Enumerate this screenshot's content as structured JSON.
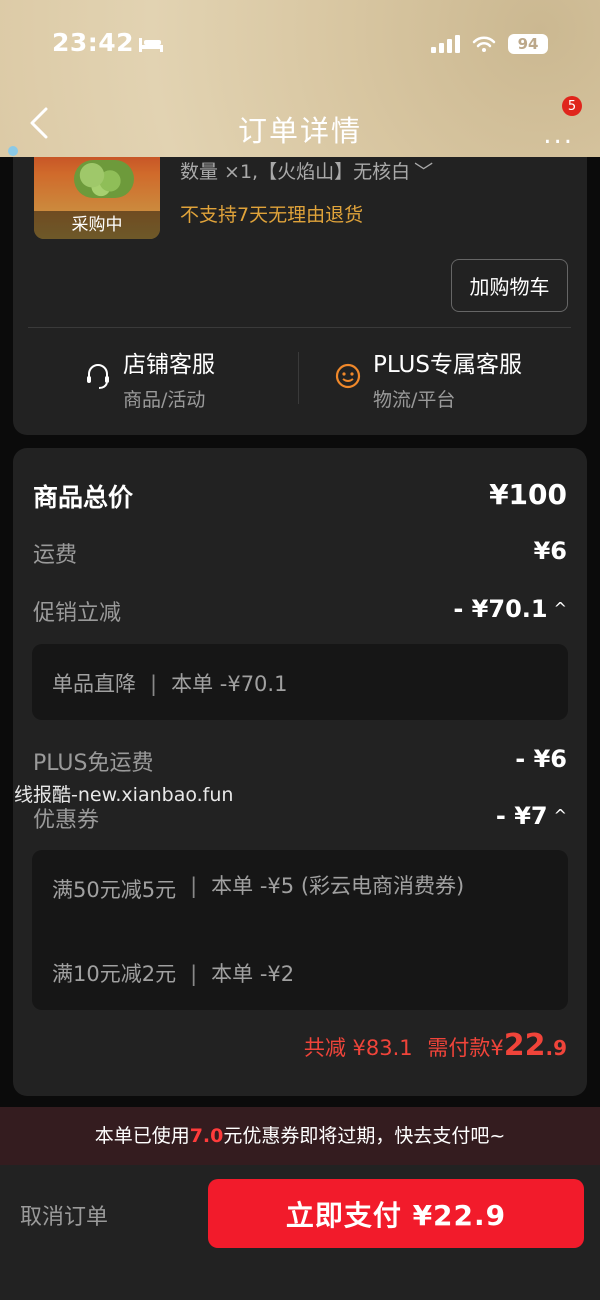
{
  "status_bar": {
    "time": "23:42",
    "battery": "94"
  },
  "header": {
    "title": "订单详情",
    "more": "...",
    "badge": "5"
  },
  "product": {
    "thumb_tag": "采购中",
    "spec": "数量 ×1,【火焰山】无核白",
    "chevron": "﹀",
    "no_return": "不支持7天无理由退货",
    "add_cart": "加购物车"
  },
  "service": {
    "shop": {
      "name": "店铺客服",
      "sub": "商品/活动"
    },
    "plus": {
      "name": "PLUS专属客服",
      "sub": "物流/平台"
    }
  },
  "price": {
    "total_label": "商品总价",
    "total_value": "¥100",
    "shipping_label": "运费",
    "shipping_value": "¥6",
    "promo_label": "促销立减",
    "promo_value": "- ¥70.1",
    "promo_detail": {
      "left": "单品直降",
      "right": "本单 -¥70.1"
    },
    "plus_ship_label": "PLUS免运费",
    "plus_ship_value": "- ¥6",
    "coupon_label": "优惠券",
    "coupon_value": "- ¥7",
    "coupon_details": [
      {
        "left": "满50元减5元",
        "right": "本单 -¥5 (彩云电商消费券)"
      },
      {
        "left": "满10元减2元",
        "right": "本单 -¥2"
      }
    ],
    "caret": "^",
    "summary": {
      "reduce_label": "共减",
      "reduce_value": "¥83.1",
      "pay_label": "需付款",
      "currency": "¥",
      "pay_int": "22",
      "pay_dec": ".9"
    }
  },
  "watermark": "线报酷-new.xianbao.fun",
  "notice": {
    "pre": "本单已使用",
    "amount": "7.0",
    "post": "元优惠券即将过期，快去支付吧~"
  },
  "footer": {
    "cancel": "取消订单",
    "pay": "立即支付 ¥22.9"
  },
  "colors": {
    "accent_red": "#f21b2b",
    "warning_orange": "#e0a33a",
    "card_bg": "#222222"
  }
}
